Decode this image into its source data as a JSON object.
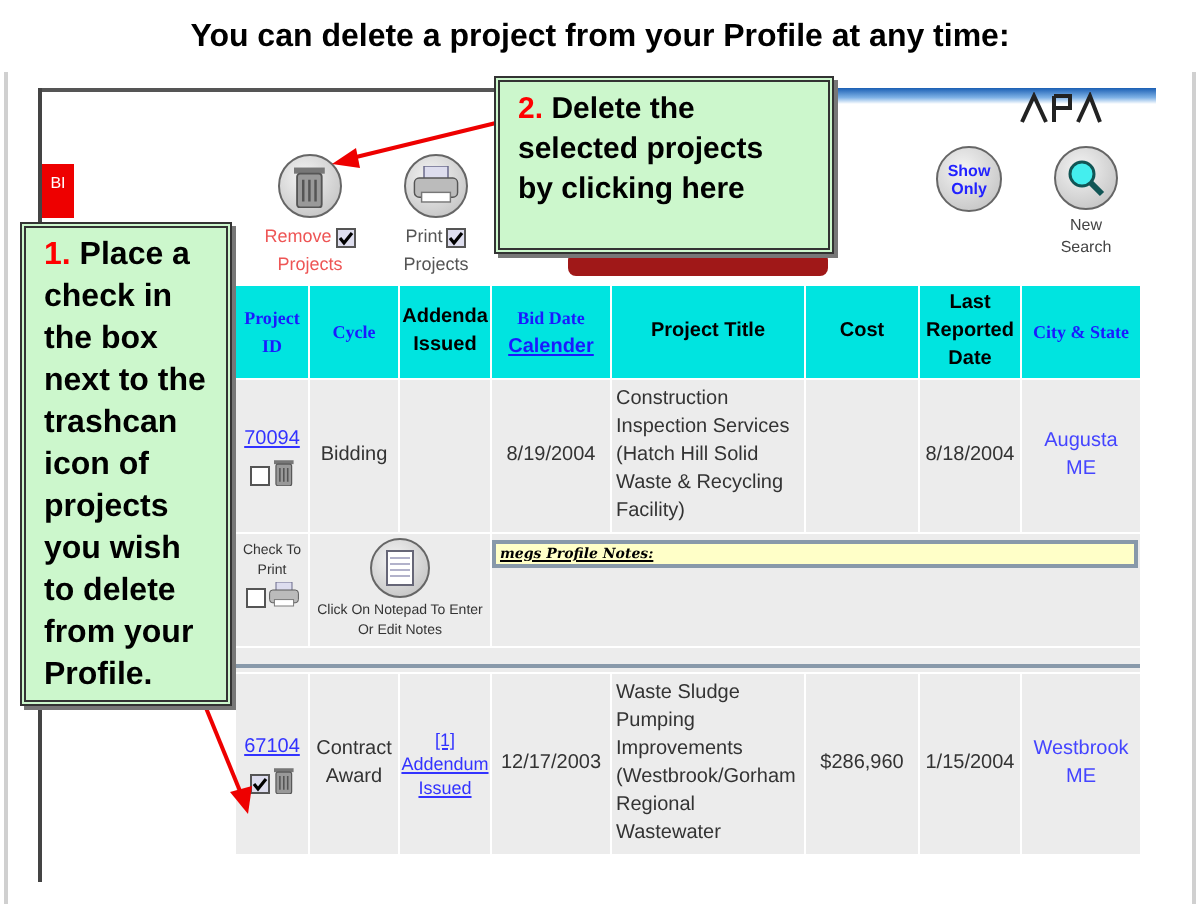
{
  "title": "You can delete a project from your Profile at any time:",
  "side_tab": "BI",
  "toolbar": [
    {
      "kind": "remove",
      "label": "Remove",
      "checked": true,
      "sublabel": "Projects"
    },
    {
      "kind": "print",
      "label": "Print",
      "checked": true,
      "sublabel": "Projects"
    }
  ],
  "show_only": "Show Only",
  "new_search": "New Search",
  "columns": [
    {
      "label": "Project ID",
      "kind": "serif"
    },
    {
      "label": "Cycle",
      "kind": "serif"
    },
    {
      "label": "Addenda Issued",
      "kind": "plain"
    },
    {
      "label": "Bid Date",
      "kind": "serif",
      "link": "Calender"
    },
    {
      "label": "Project Title",
      "kind": "plain"
    },
    {
      "label": "Cost",
      "kind": "plain"
    },
    {
      "label": "Last Reported Date",
      "kind": "plain"
    },
    {
      "label": "City & State",
      "kind": "serif"
    }
  ],
  "rows": [
    {
      "kind": "project",
      "id": "70094",
      "checked": false,
      "cycle": "Bidding",
      "addenda": "",
      "bid_date": "8/19/2004",
      "title": "Construction Inspection Services (Hatch Hill Solid Waste & Recycling Facility)",
      "cost": "",
      "reported": "8/18/2004",
      "city": "Augusta",
      "state": "ME"
    },
    {
      "kind": "notes",
      "check_label": "Check To Print",
      "checked": false,
      "notepad_label": "Click On Notepad To Enter Or Edit Notes",
      "notes_title": "megs Profile Notes:"
    },
    {
      "kind": "project",
      "id": "67104",
      "checked": true,
      "cycle": "Contract Award",
      "addenda": "[1] Addendum Issued",
      "bid_date": "12/17/2003",
      "title": "Waste Sludge Pumping Improvements (Westbrook/Gorham Regional Wastewater",
      "cost": "$286,960",
      "reported": "1/15/2004",
      "city": "Westbrook",
      "state": "ME"
    }
  ],
  "callouts": [
    {
      "number": "1.",
      "text": "Place a check in the box next to the trashcan icon of projects you wish to delete from your Profile."
    },
    {
      "number": "2.",
      "text": "Delete the selected projects by clicking here"
    }
  ]
}
